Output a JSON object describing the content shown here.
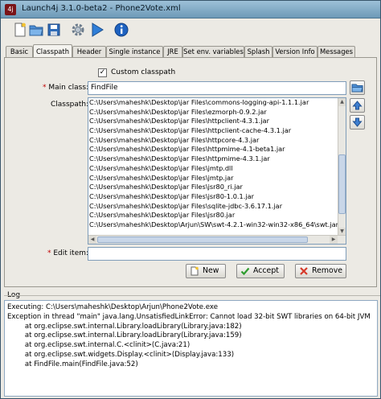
{
  "window": {
    "title": "Launch4j 3.1.0-beta2 - Phone2Vote.xml",
    "app_icon_glyph": "4j"
  },
  "toolbar": {
    "buttons": [
      {
        "name": "new-file-icon"
      },
      {
        "name": "open-folder-icon"
      },
      {
        "name": "save-icon"
      },
      {
        "name": "gear-icon"
      },
      {
        "name": "run-icon"
      },
      {
        "name": "info-icon"
      }
    ]
  },
  "tabs": [
    "Basic",
    "Classpath",
    "Header",
    "Single instance",
    "JRE",
    "Set env. variables",
    "Splash",
    "Version Info",
    "Messages"
  ],
  "active_tab": "Classpath",
  "classpath": {
    "custom_checked": true,
    "custom_mark": "✓",
    "custom_label": "Custom classpath",
    "required_marker": "*",
    "main_class_label": "Main class:",
    "main_class_value": "FindFile",
    "classpath_label": "Classpath:",
    "entries": [
      "C:\\Users\\maheshk\\Desktop\\jar Files\\commons-logging-api-1.1.1.jar",
      "C:\\Users\\maheshk\\Desktop\\jar Files\\ezmorph-0.9.2.jar",
      "C:\\Users\\maheshk\\Desktop\\jar Files\\httpclient-4.3.1.jar",
      "C:\\Users\\maheshk\\Desktop\\jar Files\\httpclient-cache-4.3.1.jar",
      "C:\\Users\\maheshk\\Desktop\\jar Files\\httpcore-4.3.jar",
      "C:\\Users\\maheshk\\Desktop\\jar Files\\httpmime-4.1-beta1.jar",
      "C:\\Users\\maheshk\\Desktop\\jar Files\\httpmime-4.3.1.jar",
      "C:\\Users\\maheshk\\Desktop\\jar Files\\jmtp.dll",
      "C:\\Users\\maheshk\\Desktop\\jar Files\\jmtp.jar",
      "C:\\Users\\maheshk\\Desktop\\jar Files\\jsr80_ri.jar",
      "C:\\Users\\maheshk\\Desktop\\jar Files\\jsr80-1.0.1.jar",
      "C:\\Users\\maheshk\\Desktop\\jar Files\\sqlite-jdbc-3.6.17.1.jar",
      "C:\\Users\\maheshk\\Desktop\\jar Files\\jsr80.jar",
      "C:\\Users\\maheshk\\Desktop\\Arjun\\SW\\swt-4.2.1-win32-win32-x86_64\\swt.jar"
    ],
    "edit_item_label": "Edit item:",
    "edit_item_value": "",
    "buttons": {
      "new": "New",
      "accept": "Accept",
      "remove": "Remove"
    }
  },
  "log": {
    "title": "Log",
    "lines": [
      "Executing: C:\\Users\\maheshk\\Desktop\\Arjun\\Phone2Vote.exe",
      "Exception in thread \"main\" java.lang.UnsatisfiedLinkError: Cannot load 32-bit SWT libraries on 64-bit JVM",
      "        at org.eclipse.swt.internal.Library.loadLibrary(Library.java:182)",
      "        at org.eclipse.swt.internal.Library.loadLibrary(Library.java:159)",
      "        at org.eclipse.swt.internal.C.<clinit>(C.java:21)",
      "        at org.eclipse.swt.widgets.Display.<clinit>(Display.java:133)",
      "        at FindFile.main(FindFile.java:52)"
    ]
  },
  "colors": {
    "accept_green": "#2e9c2e",
    "remove_red": "#d63a2a",
    "required_red": "#c00000",
    "selection_blue": "#3b6fb6"
  }
}
